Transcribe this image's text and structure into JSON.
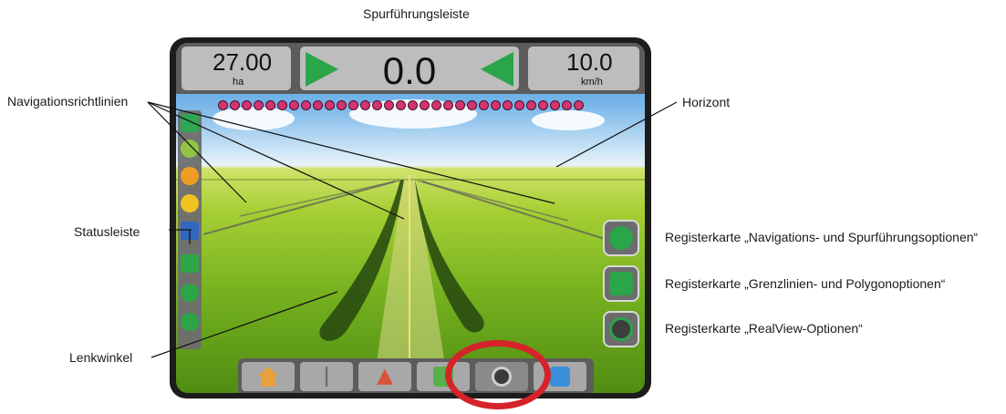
{
  "callouts": {
    "guidance_bar": "Spurführungsleiste",
    "nav_guidelines": "Navigationsrichtlinien",
    "horizon": "Horizont",
    "status_bar": "Statusleiste",
    "tab_navigation": "Registerkarte „Navigations- und Spurführungsoptionen“",
    "tab_boundary": "Registerkarte „Grenzlinien- und Polygonoptionen“",
    "tab_realview": "Registerkarte „RealView-Optionen“",
    "steering_angle": "Lenkwinkel"
  },
  "device": {
    "area_value": "27.00",
    "area_unit": "ha",
    "cross_track": "0.0",
    "speed_value": "10.0",
    "speed_unit": "km/h",
    "led_count": 31
  },
  "icons": {
    "status": [
      "gps-status-icon",
      "steering-status-icon",
      "section-status-icon",
      "satellite-icon",
      "tilt-icon",
      "guidance-mode-icon",
      "rate-control-icon",
      "autosteer-icon"
    ],
    "tabs": [
      "navigation-options-icon",
      "boundary-options-icon",
      "realview-options-icon"
    ],
    "bottom": [
      "home-icon",
      "tools-icon",
      "guidance-view-icon",
      "map-view-icon",
      "realview-camera-icon",
      "layers-icon"
    ]
  },
  "colors": {
    "accent_green": "#2aa54a",
    "led_red": "#d3356f",
    "highlight_ring": "#d6232a"
  }
}
